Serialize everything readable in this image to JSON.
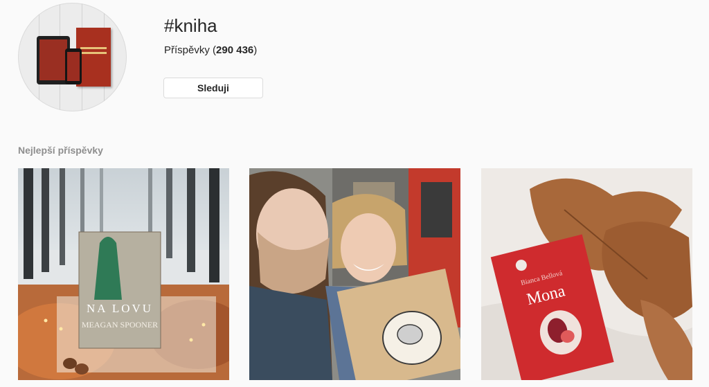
{
  "hashtag": "#kniha",
  "posts_label": "Příspěvky",
  "posts_count": "290 436",
  "follow_label": "Sleduji",
  "section_title": "Nejlepší příspěvky",
  "grid": {
    "post1": {
      "book_title": "NA LOVU",
      "book_author": "MEAGAN SPOONER"
    },
    "post2": {},
    "post3": {
      "book_author": "Bianca Bellová",
      "book_title": "Mona"
    }
  },
  "colors": {
    "background": "#fafafa",
    "text": "#262626",
    "muted": "#8e8e8e",
    "border": "#dbdbdb"
  }
}
